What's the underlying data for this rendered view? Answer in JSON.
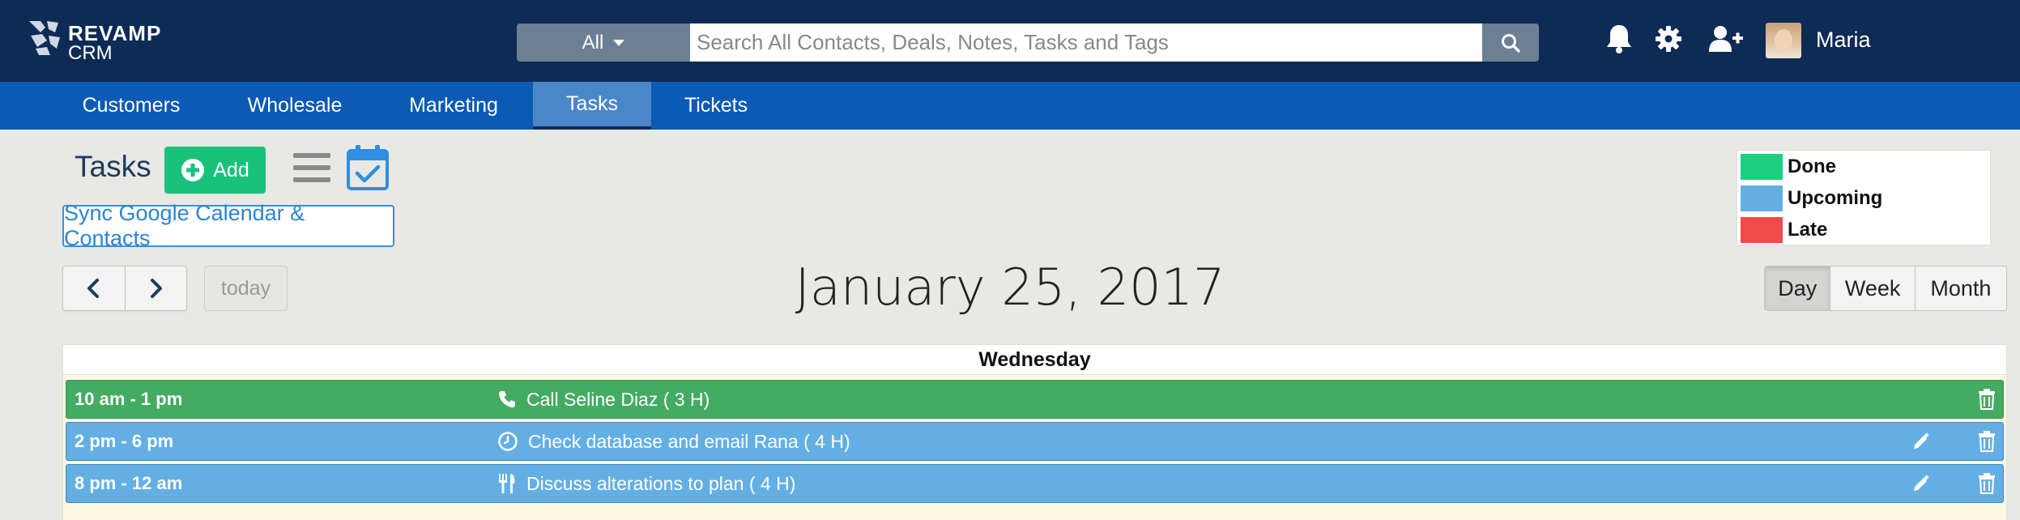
{
  "app": {
    "logo_line1": "REVAMP",
    "logo_line2": "CRM",
    "user_name": "Maria"
  },
  "search": {
    "scope": "All",
    "placeholder": "Search All Contacts, Deals, Notes, Tasks and Tags"
  },
  "nav": {
    "items": [
      "Customers",
      "Wholesale",
      "Marketing",
      "Tasks",
      "Tickets"
    ],
    "active": "Tasks"
  },
  "page": {
    "title": "Tasks",
    "add_label": "Add",
    "sync_label": "Sync Google Calendar & Contacts"
  },
  "legend": {
    "items": [
      {
        "label": "Done",
        "color": "#19d17f"
      },
      {
        "label": "Upcoming",
        "color": "#63afe4"
      },
      {
        "label": "Late",
        "color": "#f24a4a"
      }
    ]
  },
  "calendar": {
    "today_label": "today",
    "date_title": "January 25, 2017",
    "day_header": "Wednesday",
    "views": [
      "Day",
      "Week",
      "Month"
    ],
    "active_view": "Day",
    "events": [
      {
        "time": "10 am - 1 pm",
        "title": "Call Seline Diaz ( 3 H)",
        "icon": "phone-icon",
        "status": "done",
        "editable": false
      },
      {
        "time": "2 pm - 6 pm",
        "title": "Check database and email Rana ( 4 H)",
        "icon": "clock-icon",
        "status": "upcoming",
        "editable": true
      },
      {
        "time": "8 pm - 12 am",
        "title": "Discuss alterations to plan ( 4 H)",
        "icon": "utensils-icon",
        "status": "upcoming",
        "editable": true
      }
    ]
  },
  "colors": {
    "topbar": "#0d2b55",
    "navbar": "#0b5ab5",
    "nav_active": "#4a86c9",
    "add_button": "#19c27a",
    "event_done": "#44ab62",
    "event_upcoming": "#63afe4"
  }
}
